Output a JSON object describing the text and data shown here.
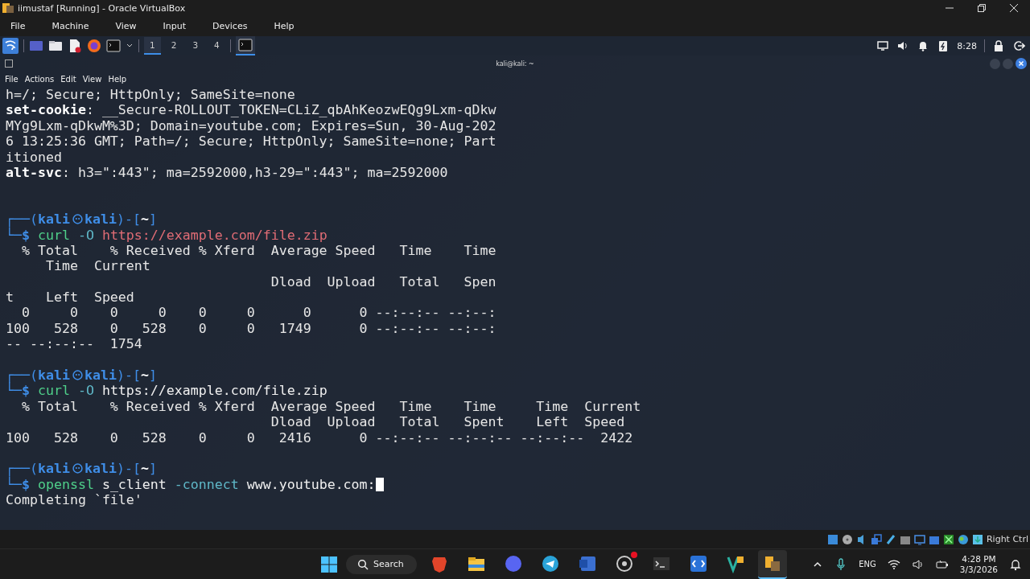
{
  "window": {
    "title": "iimustaf [Running] - Oracle VirtualBox"
  },
  "menu": [
    "File",
    "Machine",
    "View",
    "Input",
    "Devices",
    "Help"
  ],
  "panel": {
    "workspaces": [
      {
        "label": "1",
        "selected": true
      },
      {
        "label": "2",
        "selected": false
      },
      {
        "label": "3",
        "selected": false
      },
      {
        "label": "4",
        "selected": false
      }
    ],
    "clock": "8:28"
  },
  "terminal": {
    "title": "kali@kali: ~",
    "menu": [
      "File",
      "Actions",
      "Edit",
      "View",
      "Help"
    ],
    "lines": [
      {
        "kind": "text",
        "text": "h=/; Secure; HttpOnly; SameSite=none"
      },
      {
        "kind": "header",
        "key": "set-cookie",
        "text": ": __Secure-ROLLOUT_TOKEN=CLiZ_qbAhKeozwEQg9Lxm-qDkw"
      },
      {
        "kind": "text",
        "text": "MYg9Lxm-qDkwM%3D; Domain=youtube.com; Expires=Sun, 30-Aug-202"
      },
      {
        "kind": "text",
        "text": "6 13:25:36 GMT; Path=/; Secure; HttpOnly; SameSite=none; Part"
      },
      {
        "kind": "text",
        "text": "itioned"
      },
      {
        "kind": "header",
        "key": "alt-svc",
        "text": ": h3=\":443\"; ma=2592000,h3-29=\":443\"; ma=2592000"
      },
      {
        "kind": "blank"
      },
      {
        "kind": "blank"
      },
      {
        "kind": "prompt",
        "open": "┌──(",
        "user": "kali",
        "host": "kali",
        "sep": ")-[",
        "dir": "~",
        "close": "]"
      },
      {
        "kind": "command",
        "corner": "└─",
        "dollar": "$",
        "cursor": false,
        "parts": [
          {
            "kind": "program",
            "text": "curl"
          },
          {
            "kind": "option",
            "text": "-O"
          },
          {
            "kind": "path",
            "text": "https://example.com/file.zip"
          }
        ]
      },
      {
        "kind": "text",
        "text": "  % Total    % Received % Xferd  Average Speed   Time    Time"
      },
      {
        "kind": "text",
        "text": "     Time  Current"
      },
      {
        "kind": "text",
        "text": "                                 Dload  Upload   Total   Spen"
      },
      {
        "kind": "text",
        "text": "t    Left  Speed"
      },
      {
        "kind": "text",
        "text": "  0     0    0     0    0     0      0      0 --:--:-- --:--:"
      },
      {
        "kind": "text",
        "text": "100   528    0   528    0     0   1749      0 --:--:-- --:--:"
      },
      {
        "kind": "text",
        "text": "-- --:--:--  1754"
      },
      {
        "kind": "blank"
      },
      {
        "kind": "prompt",
        "open": "┌──(",
        "user": "kali",
        "host": "kali",
        "sep": ")-[",
        "dir": "~",
        "close": "]"
      },
      {
        "kind": "command",
        "corner": "└─",
        "dollar": "$",
        "cursor": false,
        "parts": [
          {
            "kind": "program",
            "text": "curl"
          },
          {
            "kind": "option",
            "text": "-O"
          },
          {
            "kind": "arg",
            "text": "https://example.com/file.zip"
          }
        ]
      },
      {
        "kind": "text",
        "text": "  % Total    % Received % Xferd  Average Speed   Time    Time     Time  Current"
      },
      {
        "kind": "text",
        "text": "                                 Dload  Upload   Total   Spent    Left  Speed"
      },
      {
        "kind": "text",
        "text": "100   528    0   528    0     0   2416      0 --:--:-- --:--:-- --:--:--  2422"
      },
      {
        "kind": "blank"
      },
      {
        "kind": "prompt",
        "open": "┌──(",
        "user": "kali",
        "host": "kali",
        "sep": ")-[",
        "dir": "~",
        "close": "]"
      },
      {
        "kind": "command",
        "corner": "└─",
        "dollar": "$",
        "cursor": true,
        "parts": [
          {
            "kind": "program",
            "text": "openssl"
          },
          {
            "kind": "arg",
            "text": "s_client"
          },
          {
            "kind": "option",
            "text": "-connect"
          },
          {
            "kind": "arg",
            "text": "www.youtube.com:"
          }
        ]
      },
      {
        "kind": "text",
        "text": "Completing `file'"
      }
    ]
  },
  "status_bar": {
    "host_key": "Right Ctrl"
  },
  "taskbar": {
    "search": "Search",
    "apps": [
      {
        "kind": "brave",
        "selected": false,
        "badge": false
      },
      {
        "kind": "files",
        "selected": false,
        "badge": false
      },
      {
        "kind": "discord",
        "selected": false,
        "badge": false
      },
      {
        "kind": "telegram",
        "selected": false,
        "badge": false
      },
      {
        "kind": "word",
        "selected": false,
        "badge": false
      },
      {
        "kind": "obs",
        "selected": false,
        "badge": true
      },
      {
        "kind": "terminal",
        "selected": false,
        "badge": false
      },
      {
        "kind": "remote",
        "selected": false,
        "badge": false
      },
      {
        "kind": "editor",
        "selected": false,
        "badge": false
      },
      {
        "kind": "virtualbox",
        "selected": true,
        "badge": false
      }
    ],
    "language": "ENG",
    "time": "4:28 PM",
    "date": "3/3/2026"
  }
}
